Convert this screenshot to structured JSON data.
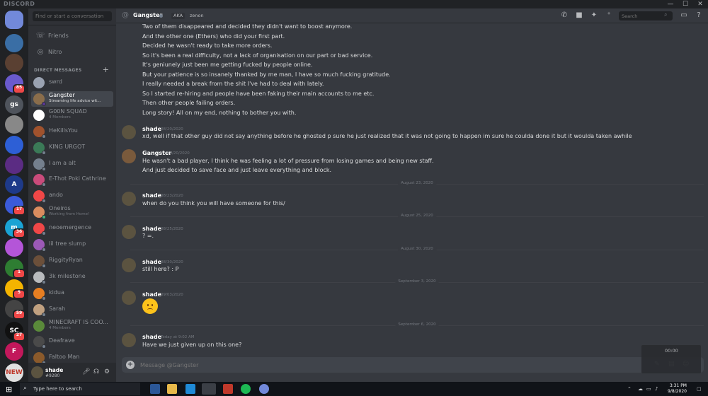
{
  "window": {
    "app_name": "DISCORD",
    "minimize": "—",
    "maximize": "☐",
    "close": "✕"
  },
  "servers": [
    {
      "label": "",
      "badge": "",
      "color": "#7289da"
    },
    {
      "label": "",
      "badge": "",
      "color": "#3a6ea5"
    },
    {
      "label": "",
      "badge": "",
      "color": "#5a4032"
    },
    {
      "label": "",
      "badge": "85",
      "color": "#6a5acd"
    },
    {
      "label": "gs",
      "badge": "",
      "color": "#4f545c"
    },
    {
      "label": "",
      "badge": "",
      "color": "#888888"
    },
    {
      "label": "",
      "badge": "",
      "color": "#2d5fd6"
    },
    {
      "label": "",
      "badge": "",
      "color": "#5b2c83"
    },
    {
      "label": "A",
      "badge": "",
      "color": "#1e3a8a"
    },
    {
      "label": "",
      "badge": "17",
      "color": "#3b5bdb"
    },
    {
      "label": "m",
      "badge": "36",
      "color": "#1aa3d4"
    },
    {
      "label": "",
      "badge": "",
      "color": "#b455d8"
    },
    {
      "label": "",
      "badge": "1",
      "color": "#2e7d32"
    },
    {
      "label": "",
      "badge": "5",
      "color": "#f4b400"
    },
    {
      "label": "",
      "badge": "59",
      "color": "#444444"
    },
    {
      "label": "SC",
      "badge": "27",
      "color": "#111111"
    },
    {
      "label": "F",
      "badge": "",
      "color": "#c2185b"
    },
    {
      "label": "NEW",
      "badge": "",
      "color": "#e0e0e0"
    }
  ],
  "sidebar": {
    "search_placeholder": "Find or start a conversation",
    "friends": "Friends",
    "nitro": "Nitro",
    "dm_header": "DIRECT MESSAGES",
    "dms": [
      {
        "name": "swrd",
        "sub": "",
        "color": "#9aa2b1",
        "status": ""
      },
      {
        "name": "Gangster",
        "sub": "Streaming life advice wit...",
        "color": "#8a6d4b",
        "status": "#593695",
        "active": true
      },
      {
        "name": "G00N SQUAD",
        "sub": "4 Members",
        "color": "#ffffff",
        "status": ""
      },
      {
        "name": "HeKillsYou",
        "sub": "",
        "color": "#a0522d",
        "status": "#747f8d"
      },
      {
        "name": "KING URGOT",
        "sub": "",
        "color": "#3b7a57",
        "status": "#747f8d"
      },
      {
        "name": "I am a alt",
        "sub": "",
        "color": "#747f8d",
        "status": "#747f8d"
      },
      {
        "name": "E-Thot Poki Cathrine",
        "sub": "",
        "color": "#c94b7b",
        "status": "#747f8d"
      },
      {
        "name": "ando",
        "sub": "",
        "color": "#f04747",
        "status": "#747f8d"
      },
      {
        "name": "Oneiros",
        "sub": "Working from Home!",
        "color": "#d98c5f",
        "status": "#43b581"
      },
      {
        "name": "neoemergence",
        "sub": "",
        "color": "#f04747",
        "status": "#747f8d"
      },
      {
        "name": "lil tree slump",
        "sub": "",
        "color": "#9b59b6",
        "status": "#747f8d"
      },
      {
        "name": "RiggityRyan",
        "sub": "",
        "color": "#6b4f3a",
        "status": "#747f8d"
      },
      {
        "name": "3k milestone",
        "sub": "",
        "color": "#b9bbbe",
        "status": "#747f8d"
      },
      {
        "name": "kidua",
        "sub": "",
        "color": "#e67e22",
        "status": "#747f8d"
      },
      {
        "name": "Sarah",
        "sub": "",
        "color": "#c0a080",
        "status": "#747f8d"
      },
      {
        "name": "MINECRAFT IS COO...",
        "sub": "4 Members",
        "color": "#5a8a3a",
        "status": ""
      },
      {
        "name": "Deafrave",
        "sub": "",
        "color": "#4a4a4a",
        "status": "#747f8d"
      },
      {
        "name": "Faltoo Man",
        "sub": "",
        "color": "#8b5a2b",
        "status": "#747f8d"
      }
    ]
  },
  "user": {
    "name": "shade",
    "tag": "#9280"
  },
  "header": {
    "name": "Gangster",
    "aka": "AKA",
    "aka_value": "zenon",
    "search_placeholder": "Search"
  },
  "messages": {
    "gangster_cont": [
      "Two of them disappeared and decided they didn't want to boost anymore.",
      "And the other one (Ethers) who did your first part.",
      "Decided he wasn't ready to take more orders.",
      "So it's been a real difficulty, not a lack of organisation on our part or bad service.",
      "It's geniunely just been me getting fucked by people online.",
      "But your patience is so insanely thanked by me man, I have so much fucking gratitude.",
      "I really needed a break from the shit I've had to deal with lately.",
      "So I started re-hiring and people have been faking their main accounts to me etc.",
      "Then other people failing orders.",
      "Long story! All on my end, nothing to bother you with."
    ],
    "m1": {
      "author": "shade",
      "time": "08/20/2020",
      "text": "xd, well if that other guy did not say anything before he ghosted p sure he just realized that it was not going to happen im sure he coulda done it but it woulda taken awhile"
    },
    "m2": {
      "author": "Gangster",
      "time": "08/20/2020",
      "lines": [
        "He wasn't a bad player, I think he was feeling a lot of pressure from losing games and being new staff.",
        "And just decided to save face and just leave everything and block."
      ]
    },
    "d1": "August 23, 2020",
    "m3": {
      "author": "shade",
      "time": "08/23/2020",
      "text": "when do you think you will have someone for this/"
    },
    "d2": "August 25, 2020",
    "m4": {
      "author": "shade",
      "time": "08/25/2020",
      "text": "? =."
    },
    "d3": "August 30, 2020",
    "m5": {
      "author": "shade",
      "time": "08/30/2020",
      "text": "still here? : P"
    },
    "d4": "September 3, 2020",
    "m6": {
      "author": "shade",
      "time": "09/03/2020"
    },
    "d5": "September 6, 2020",
    "m7": {
      "author": "shade",
      "time": "Today at 9:02 AM",
      "text": "Have we just given up on this one?"
    }
  },
  "composer": {
    "placeholder": "Message @Gangster"
  },
  "overlay": {
    "time": "00:00"
  },
  "taskbar": {
    "search_placeholder": "Type here to search",
    "time": "3:31 PM",
    "date": "9/8/2020"
  }
}
